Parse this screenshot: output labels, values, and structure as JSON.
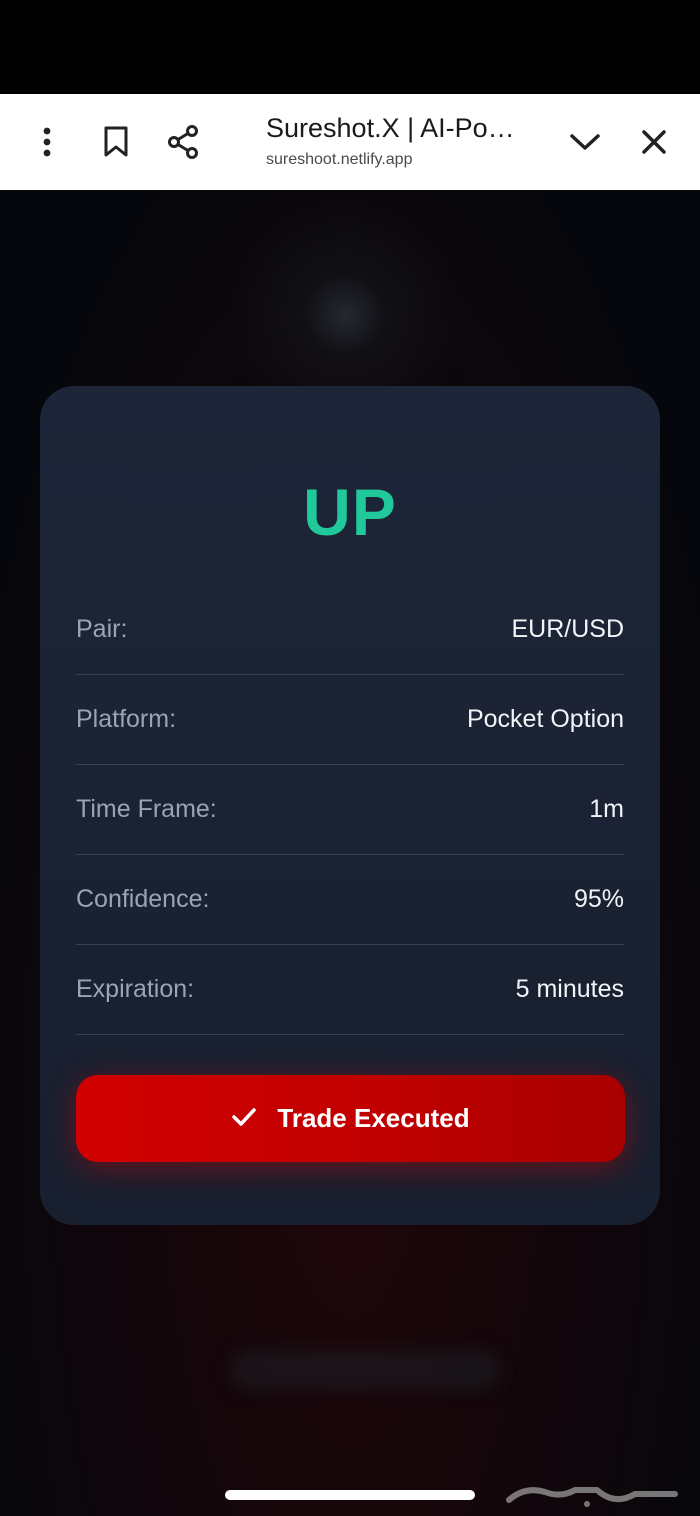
{
  "browser": {
    "tab_title": "Sureshot.X | AI-Po…",
    "url": "sureshoot.netlify.app",
    "icons": [
      "more-vert-icon",
      "bookmark-icon",
      "share-icon",
      "chevron-down-icon",
      "close-icon"
    ]
  },
  "signal": {
    "direction": "UP",
    "rows": [
      {
        "label": "Pair:",
        "value": "EUR/USD"
      },
      {
        "label": "Platform:",
        "value": "Pocket Option"
      },
      {
        "label": "Time Frame:",
        "value": "1m"
      },
      {
        "label": "Confidence:",
        "value": "95%"
      },
      {
        "label": "Expiration:",
        "value": "5 minutes"
      }
    ],
    "button_label": "Trade Executed",
    "button_icon": "check-icon"
  },
  "colors": {
    "direction": "#20c99a",
    "button": "#c20000",
    "card": "#1b2335"
  }
}
